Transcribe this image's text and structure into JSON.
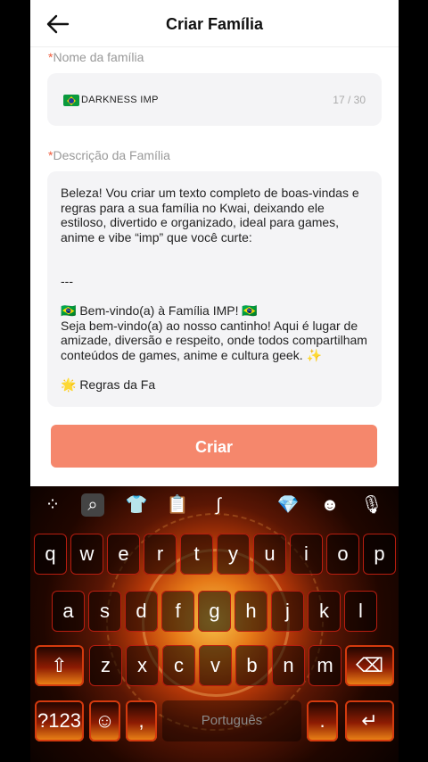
{
  "header": {
    "title": "Criar Família"
  },
  "form": {
    "name_label": "Nome da família",
    "name_value": "DARKNESS IMP",
    "name_counter": "17 / 30",
    "description_label": "Descrição da Família",
    "description_value": "Beleza! Vou criar um texto completo de boas-vindas e regras para a sua família no Kwai, deixando ele estiloso, divertido e organizado, ideal para games, anime e vibe “imp” que você curte:\n\n\n---\n\n🇧🇷 Bem-vindo(a) à Família IMP! 🇧🇷\nSeja bem-vindo(a) ao nosso cantinho! Aqui é lugar de amizade, diversão e respeito, onde todos compartilham conteúdos de games, anime e cultura geek. ✨\n\n🌟 Regras da Fa",
    "required_mark": "*",
    "submit_label": "Criar"
  },
  "keyboard": {
    "toolbar": [
      {
        "icon": "apps-grid-icon",
        "glyph": "⁘"
      },
      {
        "icon": "search-icon",
        "glyph": "⌕"
      },
      {
        "icon": "shirt-icon",
        "glyph": "👕"
      },
      {
        "icon": "clipboard-icon",
        "glyph": "📋"
      },
      {
        "icon": "sticker-icon",
        "glyph": "∫"
      },
      {
        "icon": "gem-icon",
        "glyph": "💎"
      },
      {
        "icon": "emoji-icon",
        "glyph": "☻"
      },
      {
        "icon": "microphone-icon",
        "glyph": "🎙"
      }
    ],
    "row1": [
      "q",
      "w",
      "e",
      "r",
      "t",
      "y",
      "u",
      "i",
      "o",
      "p"
    ],
    "row2": [
      "a",
      "s",
      "d",
      "f",
      "g",
      "h",
      "j",
      "k",
      "l"
    ],
    "row3": [
      "z",
      "x",
      "c",
      "v",
      "b",
      "n",
      "m"
    ],
    "symbols_label": "?123",
    "comma_label": ",",
    "space_label": "Português",
    "period_label": ".",
    "shift_glyph": "⇧",
    "backspace_glyph": "⌫",
    "enter_glyph": "↵",
    "emoji_glyph": "☺",
    "accent_color": "#f5876c"
  }
}
